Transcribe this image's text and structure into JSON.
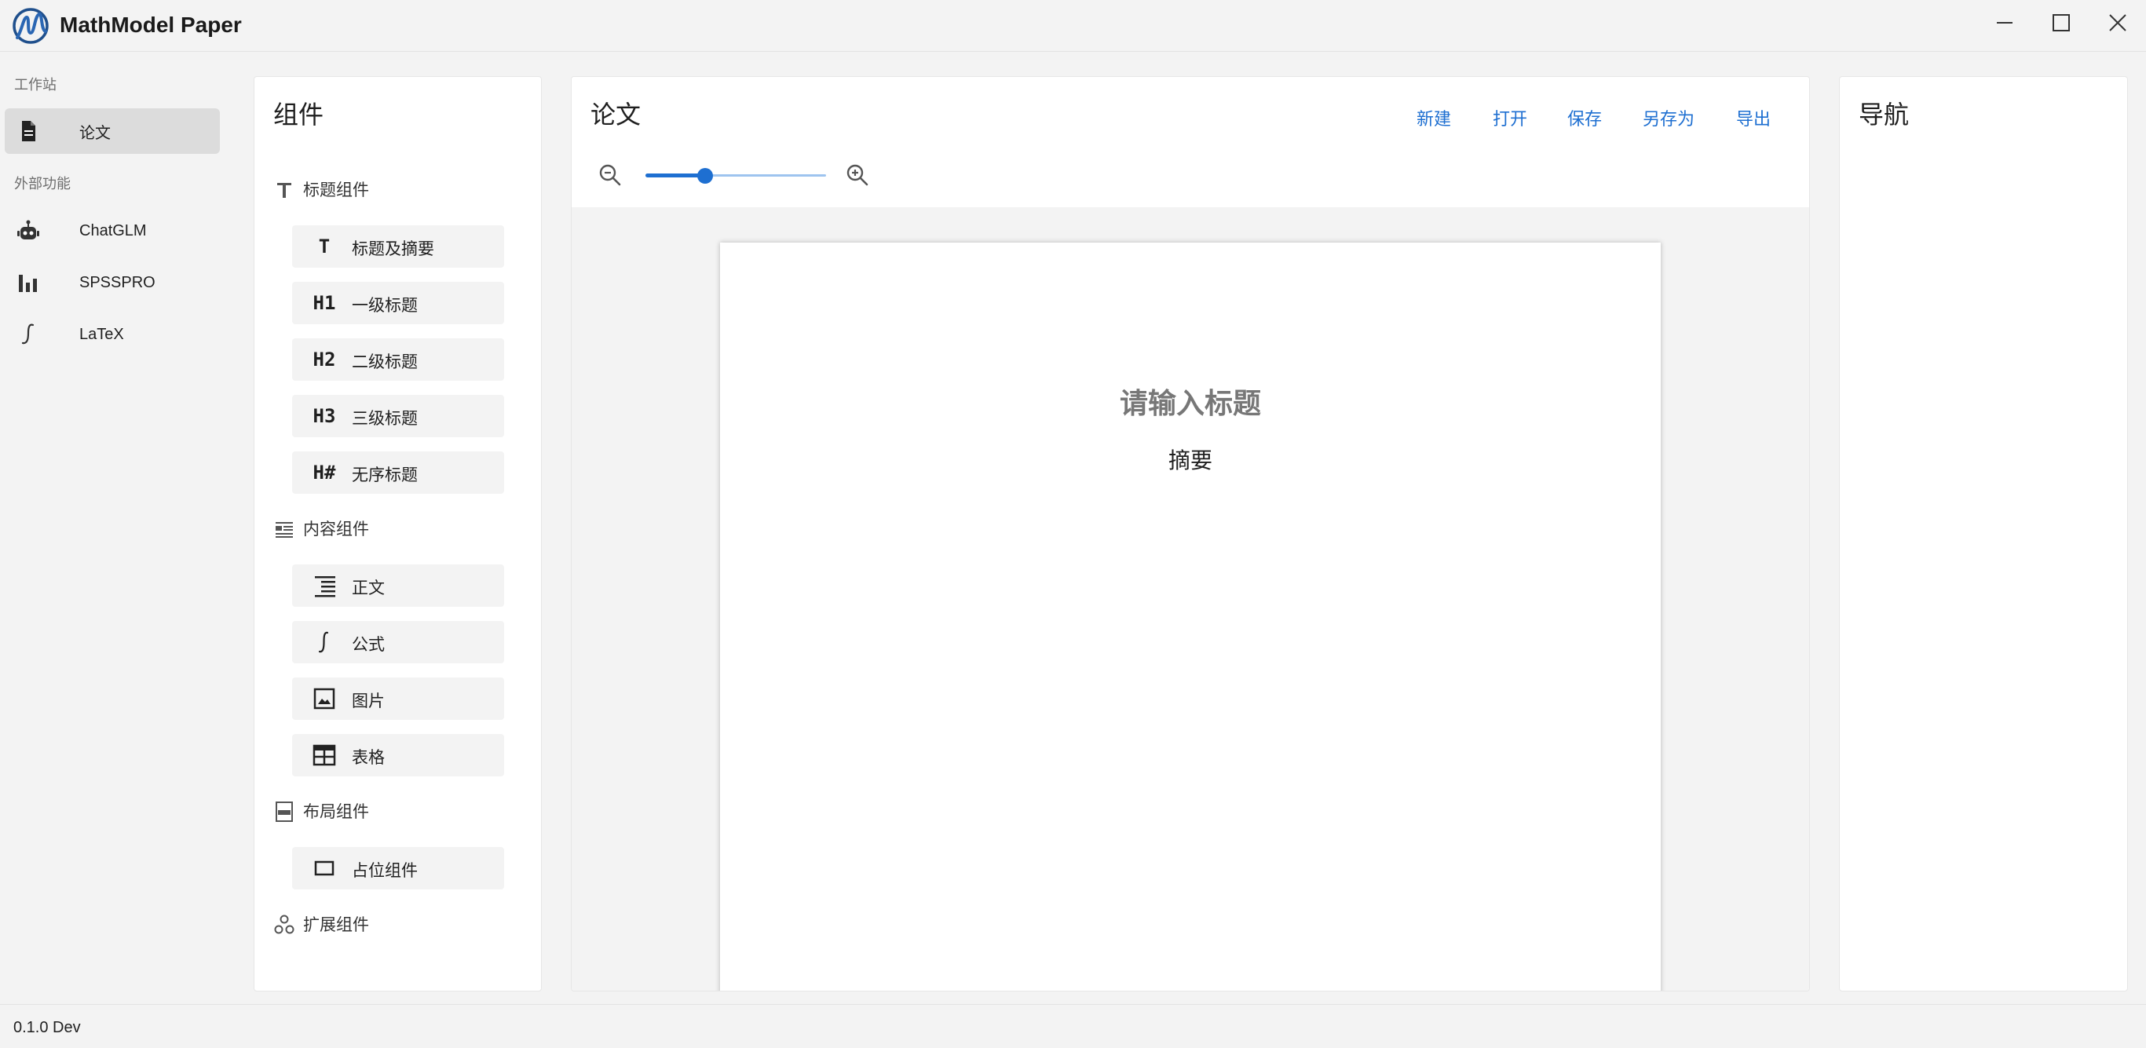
{
  "app": {
    "title": "MathModel Paper",
    "version": "0.1.0 Dev"
  },
  "window_controls": {
    "icons": [
      "minimize-icon",
      "maximize-icon",
      "close-icon"
    ]
  },
  "sidebar": {
    "sections": [
      {
        "label": "工作站",
        "items": [
          {
            "label": "论文",
            "icon": "document-icon",
            "active": true
          }
        ]
      },
      {
        "label": "外部功能",
        "items": [
          {
            "label": "ChatGLM",
            "icon": "robot-icon"
          },
          {
            "label": "SPSSPRO",
            "icon": "bar-chart-icon"
          },
          {
            "label": "LaTeX",
            "icon": "integral-icon"
          }
        ]
      }
    ]
  },
  "components": {
    "title": "组件",
    "groups": [
      {
        "label": "标题组件",
        "icon": "title-icon",
        "items": [
          {
            "label": "标题及摘要",
            "glyph": "T"
          },
          {
            "label": "一级标题",
            "glyph": "H1"
          },
          {
            "label": "二级标题",
            "glyph": "H2"
          },
          {
            "label": "三级标题",
            "glyph": "H3"
          },
          {
            "label": "无序标题",
            "glyph": "H#"
          }
        ]
      },
      {
        "label": "内容组件",
        "icon": "content-icon",
        "items": [
          {
            "label": "正文",
            "glyph": "align-right-icon"
          },
          {
            "label": "公式",
            "glyph": "integral-icon"
          },
          {
            "label": "图片",
            "glyph": "image-icon"
          },
          {
            "label": "表格",
            "glyph": "table-icon"
          }
        ]
      },
      {
        "label": "布局组件",
        "icon": "layout-icon",
        "items": [
          {
            "label": "占位组件",
            "glyph": "placeholder-icon"
          }
        ]
      },
      {
        "label": "扩展组件",
        "icon": "extension-icon",
        "items": []
      }
    ]
  },
  "editor": {
    "title": "论文",
    "toolbar": {
      "new": "新建",
      "open": "打开",
      "save": "保存",
      "save_as": "另存为",
      "export": "导出"
    },
    "zoom": {
      "value": 0.33,
      "colors": {
        "accent": "#1e6fd1"
      }
    },
    "paper": {
      "title_placeholder": "请输入标题",
      "abstract_label": "摘要"
    }
  },
  "navigation": {
    "title": "导航"
  }
}
